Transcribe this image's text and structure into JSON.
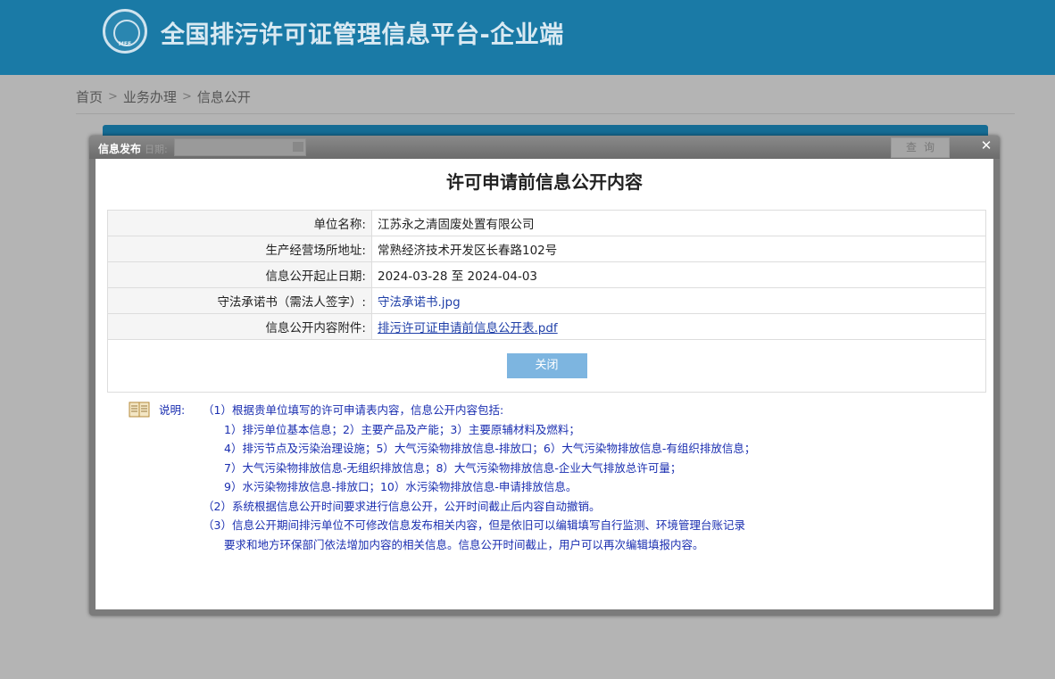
{
  "header": {
    "logo_text": "MEE",
    "title": "全国排污许可证管理信息平台-企业端"
  },
  "breadcrumb": {
    "items": [
      "首页",
      "业务办理",
      "信息公开"
    ],
    "separator": ">"
  },
  "modal": {
    "header_title": "信息发布",
    "ghost_date_label": "日期:",
    "ghost_query_button": "查询",
    "close_symbol": "✕",
    "title": "许可申请前信息公开内容",
    "rows": [
      {
        "label": "单位名称:",
        "value": "江苏永之清固废处置有限公司"
      },
      {
        "label": "生产经营场所地址:",
        "value": "常熟经济技术开发区长春路102号"
      },
      {
        "label": "信息公开起止日期:",
        "value": "2024-03-28 至 2024-04-03"
      },
      {
        "label": "守法承诺书（需法人签字）:",
        "value": "守法承诺书.jpg"
      },
      {
        "label": "信息公开内容附件:",
        "value": "排污许可证申请前信息公开表.pdf"
      }
    ],
    "close_button": "关闭"
  },
  "notes": {
    "label": "说明:",
    "lines": [
      "（1）根据贵单位填写的许可申请表内容，信息公开内容包括:",
      "1）排污单位基本信息；2）主要产品及产能；3）主要原辅材料及燃料；",
      "4）排污节点及污染治理设施；5）大气污染物排放信息-排放口；6）大气污染物排放信息-有组织排放信息；",
      "7）大气污染物排放信息-无组织排放信息；8）大气污染物排放信息-企业大气排放总许可量；",
      "9）水污染物排放信息-排放口；10）水污染物排放信息-申请排放信息。",
      "（2）系统根据信息公开时间要求进行信息公开，公开时间截止后内容自动撤销。",
      "（3）信息公开期间排污单位不可修改信息发布相关内容，但是依旧可以编辑填写自行监测、环境管理台账记录",
      "要求和地方环保部门依法增加内容的相关信息。信息公开时间截止，用户可以再次编辑填报内容。"
    ]
  },
  "colors": {
    "header_bg": "#1a7aa6",
    "overlay_bg": "#b4b4b4",
    "notes_text": "#1a2eb0",
    "link": "#1f3fa8",
    "close_button_bg": "#7db5e0"
  }
}
